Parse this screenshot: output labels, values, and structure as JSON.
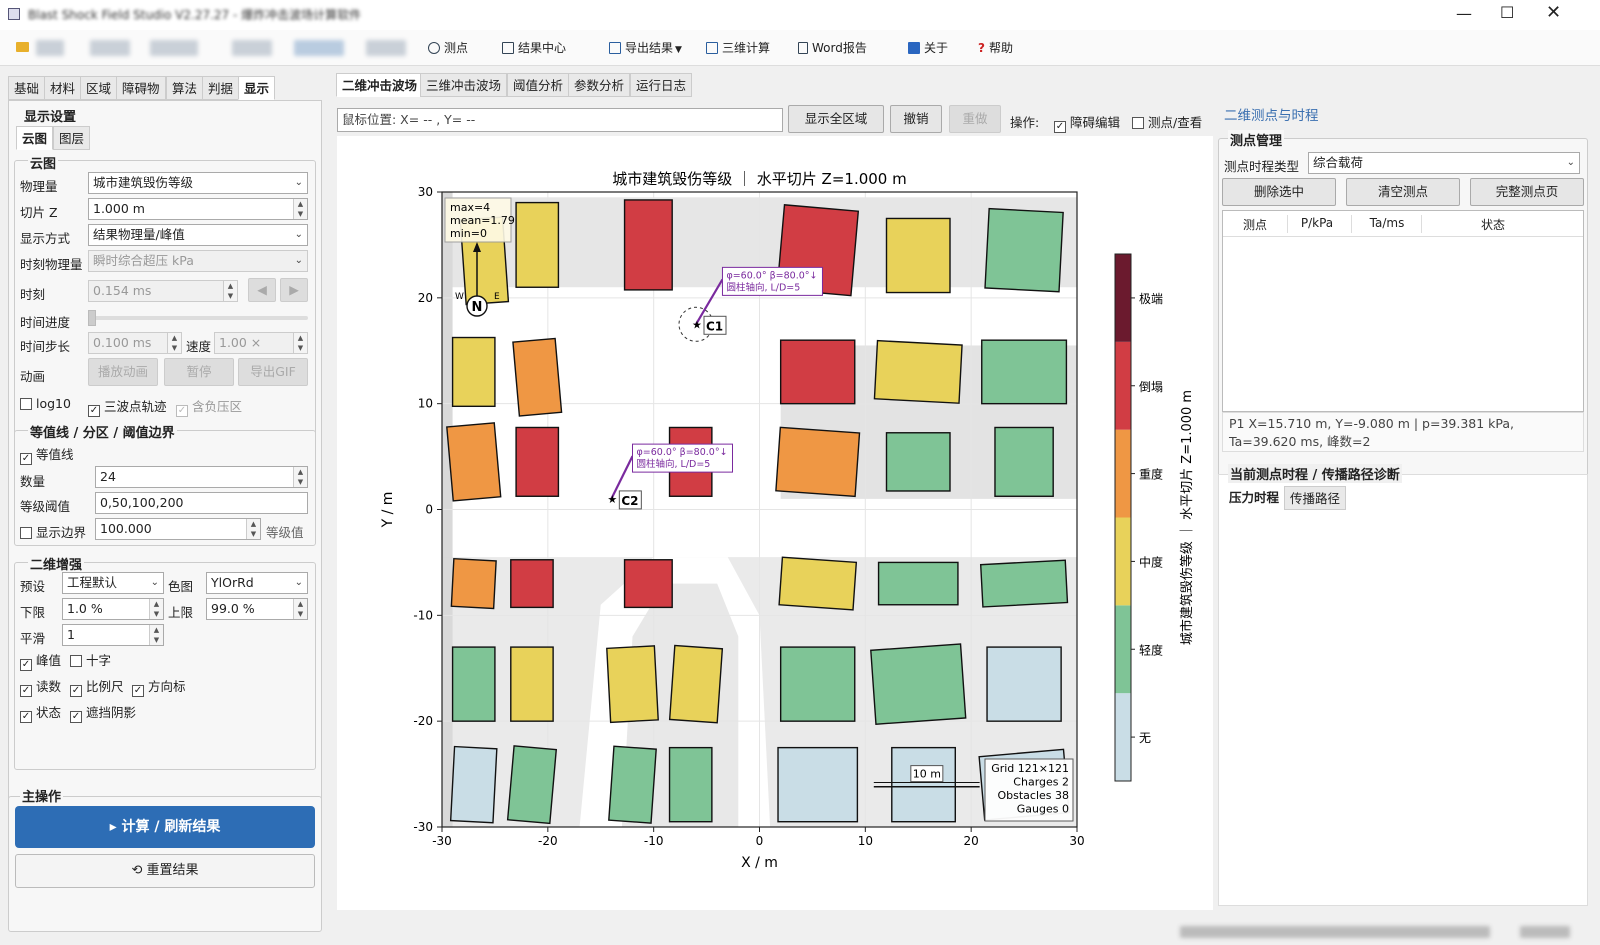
{
  "window": {
    "title": "Blast Shock Field Studio V2.27.27 - 爆炸冲击波场计算软件"
  },
  "toolbar": {
    "items": [
      {
        "label": "测点",
        "icon": "gauge-icon"
      },
      {
        "label": "结果中心",
        "icon": "results-icon"
      },
      {
        "label": "导出结果",
        "icon": "export-icon",
        "has_menu": true
      },
      {
        "label": "三维计算",
        "icon": "cube-icon"
      },
      {
        "label": "Word报告",
        "icon": "document-icon"
      },
      {
        "label": "关于",
        "icon": "info-icon"
      },
      {
        "label": "帮助",
        "icon": "help-icon"
      }
    ]
  },
  "left_tabs": [
    "基础",
    "材料",
    "区域",
    "障碍物",
    "算法",
    "判据",
    "显示"
  ],
  "left_active_tab": "显示",
  "display": {
    "group_title": "显示设置",
    "subtabs": [
      "云图",
      "图层"
    ],
    "cloud": {
      "title": "云图",
      "physical_label": "物理量",
      "physical_value": "城市建筑毁伤等级",
      "slice_label": "切片 Z",
      "slice_value": "1.000 m",
      "mode_label": "显示方式",
      "mode_value": "结果物理量/峰值",
      "time_quantity_label": "时刻物理量",
      "time_quantity_value": "瞬时综合超压 kPa",
      "time_label": "时刻",
      "time_value": "0.154 ms",
      "progress_label": "时间进度",
      "step_label": "时间步长",
      "step_value": "0.100 ms",
      "speed_label": "速度",
      "speed_value": "1.00 ×",
      "anim_label": "动画",
      "anim_play": "播放动画",
      "anim_pause": "暂停",
      "anim_gif": "导出GIF",
      "log10": "log10",
      "triwave": "三波点轨迹",
      "negative": "含负压区"
    },
    "contour": {
      "title": "等值线 / 分区 / 阈值边界",
      "enable": "等值线",
      "count_label": "数量",
      "count_value": "24",
      "levels_label": "等级阈值",
      "levels_value": "0,50,100,200",
      "border_label": "显示边界",
      "border_value": "100.000",
      "border_unit": "等级值"
    },
    "enhance": {
      "title": "二维增强",
      "preset_label": "预设",
      "preset_value": "工程默认",
      "cmap_label": "色图",
      "cmap_value": "YlOrRd",
      "lower_label": "下限",
      "lower_value": "1.0 %",
      "upper_label": "上限",
      "upper_value": "99.0 %",
      "smooth_label": "平滑",
      "smooth_value": "1",
      "checks": [
        [
          "峰值",
          "十字"
        ],
        [
          "读数",
          "比例尺",
          "方向标"
        ],
        [
          "状态",
          "遮挡阴影"
        ]
      ]
    }
  },
  "main_ops": {
    "title": "主操作",
    "compute": "▸ 计算 / 刷新结果",
    "reset": "⟲ 重置结果"
  },
  "center_tabs": [
    "二维冲击波场",
    "三维冲击波场",
    "阈值分析",
    "参数分析",
    "运行日志"
  ],
  "center_active": "二维冲击波场",
  "plot_toolbar": {
    "mouse": "鼠标位置:  X= -- , Y= --",
    "show_all": "显示全区域",
    "undo": "撤销",
    "redo": "重做",
    "ops_label": "操作:",
    "obstacle_edit": "障碍编辑",
    "gauge_view": "测点/查看"
  },
  "chart_data": {
    "type": "heatmap",
    "title": "城市建筑毁伤等级 ｜ 水平切片 Z=1.000 m",
    "xlabel": "X / m",
    "ylabel": "Y / m",
    "xlim": [
      -30,
      30
    ],
    "ylim": [
      -30,
      30
    ],
    "xticks": [
      -30,
      -20,
      -10,
      0,
      10,
      20,
      30
    ],
    "yticks": [
      -30,
      -20,
      -10,
      0,
      10,
      20,
      30
    ],
    "colorbar_label": "城市建筑毁伤等级 ｜ 水平切片 Z=1.000 m",
    "categories": [
      "无",
      "轻度",
      "中度",
      "重度",
      "倒塌",
      "极端"
    ],
    "colors": [
      "#c9dde6",
      "#7fc496",
      "#e8d25a",
      "#ef9744",
      "#d13d44",
      "#6b1a2e"
    ],
    "stats": [
      "max=4",
      "mean=1.79",
      "min=0"
    ],
    "compass": {
      "n": "N",
      "w": "W",
      "e": "E"
    },
    "charges": [
      {
        "name": "C1",
        "x": -6,
        "y": 17.5,
        "note1": "φ=60.0°  β=80.0°↓",
        "note2": "圆柱轴向, L/D=5"
      },
      {
        "name": "C2",
        "x": -14,
        "y": 1,
        "note1": "φ=60.0°  β=80.0°↓",
        "note2": "圆柱轴向, L/D=5"
      }
    ],
    "scalebar": "10 m",
    "info": [
      "Grid 121×121",
      "Charges 2",
      "Obstacles 38",
      "Gauges 0"
    ],
    "buildings": [
      {
        "x": -26,
        "y": 23.5,
        "w": 4,
        "h": 8,
        "level": 2,
        "rot": -4
      },
      {
        "x": -21,
        "y": 25,
        "w": 4,
        "h": 8,
        "level": 2,
        "rot": 0
      },
      {
        "x": -10.5,
        "y": 25,
        "w": 4.5,
        "h": 8.5,
        "level": 4,
        "rot": 0
      },
      {
        "x": 5.5,
        "y": 24.5,
        "w": 7,
        "h": 8,
        "level": 4,
        "rot": 5
      },
      {
        "x": 15,
        "y": 24,
        "w": 6,
        "h": 7,
        "level": 2,
        "rot": 0
      },
      {
        "x": 25,
        "y": 24.5,
        "w": 7,
        "h": 7.5,
        "level": 1,
        "rot": 3
      },
      {
        "x": -27,
        "y": 13,
        "w": 4,
        "h": 6.5,
        "level": 2,
        "rot": 0
      },
      {
        "x": -21,
        "y": 12.5,
        "w": 4,
        "h": 7,
        "level": 3,
        "rot": -5
      },
      {
        "x": 5.5,
        "y": 13,
        "w": 7,
        "h": 6,
        "level": 4,
        "rot": 0
      },
      {
        "x": 15,
        "y": 13,
        "w": 8,
        "h": 5.5,
        "level": 2,
        "rot": 3
      },
      {
        "x": 25,
        "y": 13,
        "w": 8,
        "h": 6,
        "level": 1,
        "rot": 0
      },
      {
        "x": -27,
        "y": 4.5,
        "w": 4.5,
        "h": 7,
        "level": 3,
        "rot": -5
      },
      {
        "x": -21,
        "y": 4.5,
        "w": 4,
        "h": 6.5,
        "level": 4,
        "rot": 0
      },
      {
        "x": -6.5,
        "y": 4.5,
        "w": 4,
        "h": 6.5,
        "level": 4,
        "rot": 0
      },
      {
        "x": 5.5,
        "y": 4.5,
        "w": 7.5,
        "h": 6,
        "level": 3,
        "rot": 4
      },
      {
        "x": 15,
        "y": 4.5,
        "w": 6,
        "h": 5.5,
        "level": 1,
        "rot": 0
      },
      {
        "x": 25,
        "y": 4.5,
        "w": 5.5,
        "h": 6.5,
        "level": 1,
        "rot": 0
      },
      {
        "x": -27,
        "y": -7,
        "w": 4,
        "h": 4.5,
        "level": 3,
        "rot": 3
      },
      {
        "x": -21.5,
        "y": -7,
        "w": 4,
        "h": 4.5,
        "level": 4,
        "rot": 0
      },
      {
        "x": -10.5,
        "y": -7,
        "w": 4.5,
        "h": 4.5,
        "level": 4,
        "rot": 0
      },
      {
        "x": 5.5,
        "y": -7,
        "w": 7,
        "h": 4.5,
        "level": 2,
        "rot": 4
      },
      {
        "x": 15,
        "y": -7,
        "w": 7.5,
        "h": 4,
        "level": 1,
        "rot": 0
      },
      {
        "x": 25,
        "y": -7,
        "w": 8,
        "h": 4,
        "level": 1,
        "rot": -3
      },
      {
        "x": -27,
        "y": -16.5,
        "w": 4,
        "h": 7,
        "level": 1,
        "rot": 0
      },
      {
        "x": -21.5,
        "y": -16.5,
        "w": 4,
        "h": 7,
        "level": 2,
        "rot": 0
      },
      {
        "x": -12,
        "y": -16.5,
        "w": 4.5,
        "h": 7,
        "level": 2,
        "rot": -3
      },
      {
        "x": -6,
        "y": -16.5,
        "w": 4.5,
        "h": 7,
        "level": 2,
        "rot": 4
      },
      {
        "x": 5.5,
        "y": -16.5,
        "w": 7,
        "h": 7,
        "level": 1,
        "rot": 0
      },
      {
        "x": 15,
        "y": -16.5,
        "w": 8.5,
        "h": 7,
        "level": 1,
        "rot": -4
      },
      {
        "x": 25,
        "y": -16.5,
        "w": 7,
        "h": 7,
        "level": 0,
        "rot": 0
      },
      {
        "x": -27,
        "y": -26,
        "w": 4,
        "h": 7,
        "level": 0,
        "rot": 3
      },
      {
        "x": -21.5,
        "y": -26,
        "w": 4,
        "h": 7,
        "level": 1,
        "rot": 5
      },
      {
        "x": -12,
        "y": -26,
        "w": 4,
        "h": 7,
        "level": 1,
        "rot": 4
      },
      {
        "x": -6.5,
        "y": -26,
        "w": 4,
        "h": 7,
        "level": 1,
        "rot": 0
      },
      {
        "x": 5.5,
        "y": -26,
        "w": 7.5,
        "h": 7,
        "level": 0,
        "rot": 0
      },
      {
        "x": 15.5,
        "y": -26,
        "w": 6,
        "h": 7,
        "level": 0,
        "rot": 0
      },
      {
        "x": 25,
        "y": -26,
        "w": 8,
        "h": 6,
        "level": 0,
        "rot": -5
      }
    ]
  },
  "right": {
    "title": "二维测点与时程",
    "manage_title": "测点管理",
    "type_label": "测点时程类型",
    "type_value": "综合载荷",
    "delete": "删除选中",
    "clear": "清空测点",
    "full": "完整测点页",
    "columns": [
      "测点",
      "P/kPa",
      "Ta/ms",
      "状态"
    ],
    "info": [
      "P1  X=15.710 m, Y=-9.080 m  |  p=39.381 kPa,",
      "Ta=39.620 ms, 峰数=2"
    ],
    "diag_title": "当前测点时程 / 传播路径诊断",
    "diag_tabs": [
      "压力时程",
      "传播路径"
    ]
  }
}
